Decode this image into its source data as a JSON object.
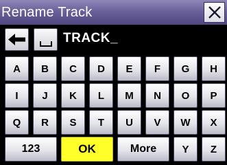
{
  "window": {
    "title": "Rename Track",
    "close_icon": "close-x-icon"
  },
  "entry": {
    "backspace_icon": "backspace-arrow-icon",
    "space_icon": "space-bar-icon",
    "text": "TRACK_"
  },
  "keyboard": {
    "rows": [
      [
        "A",
        "B",
        "C",
        "D",
        "E",
        "F",
        "G",
        "H"
      ],
      [
        "I",
        "J",
        "K",
        "L",
        "M",
        "N",
        "O",
        "P"
      ],
      [
        "Q",
        "R",
        "S",
        "T",
        "U",
        "V",
        "W",
        "X"
      ]
    ],
    "bottom": {
      "numbers_label": "123",
      "ok_label": "OK",
      "more_label": "More",
      "y_label": "Y",
      "z_label": "Z"
    }
  },
  "colors": {
    "title_bar": "#6a619a",
    "ok_highlight": "#ffff2a",
    "key_face": "#e4e4ea",
    "background": "#000000"
  }
}
